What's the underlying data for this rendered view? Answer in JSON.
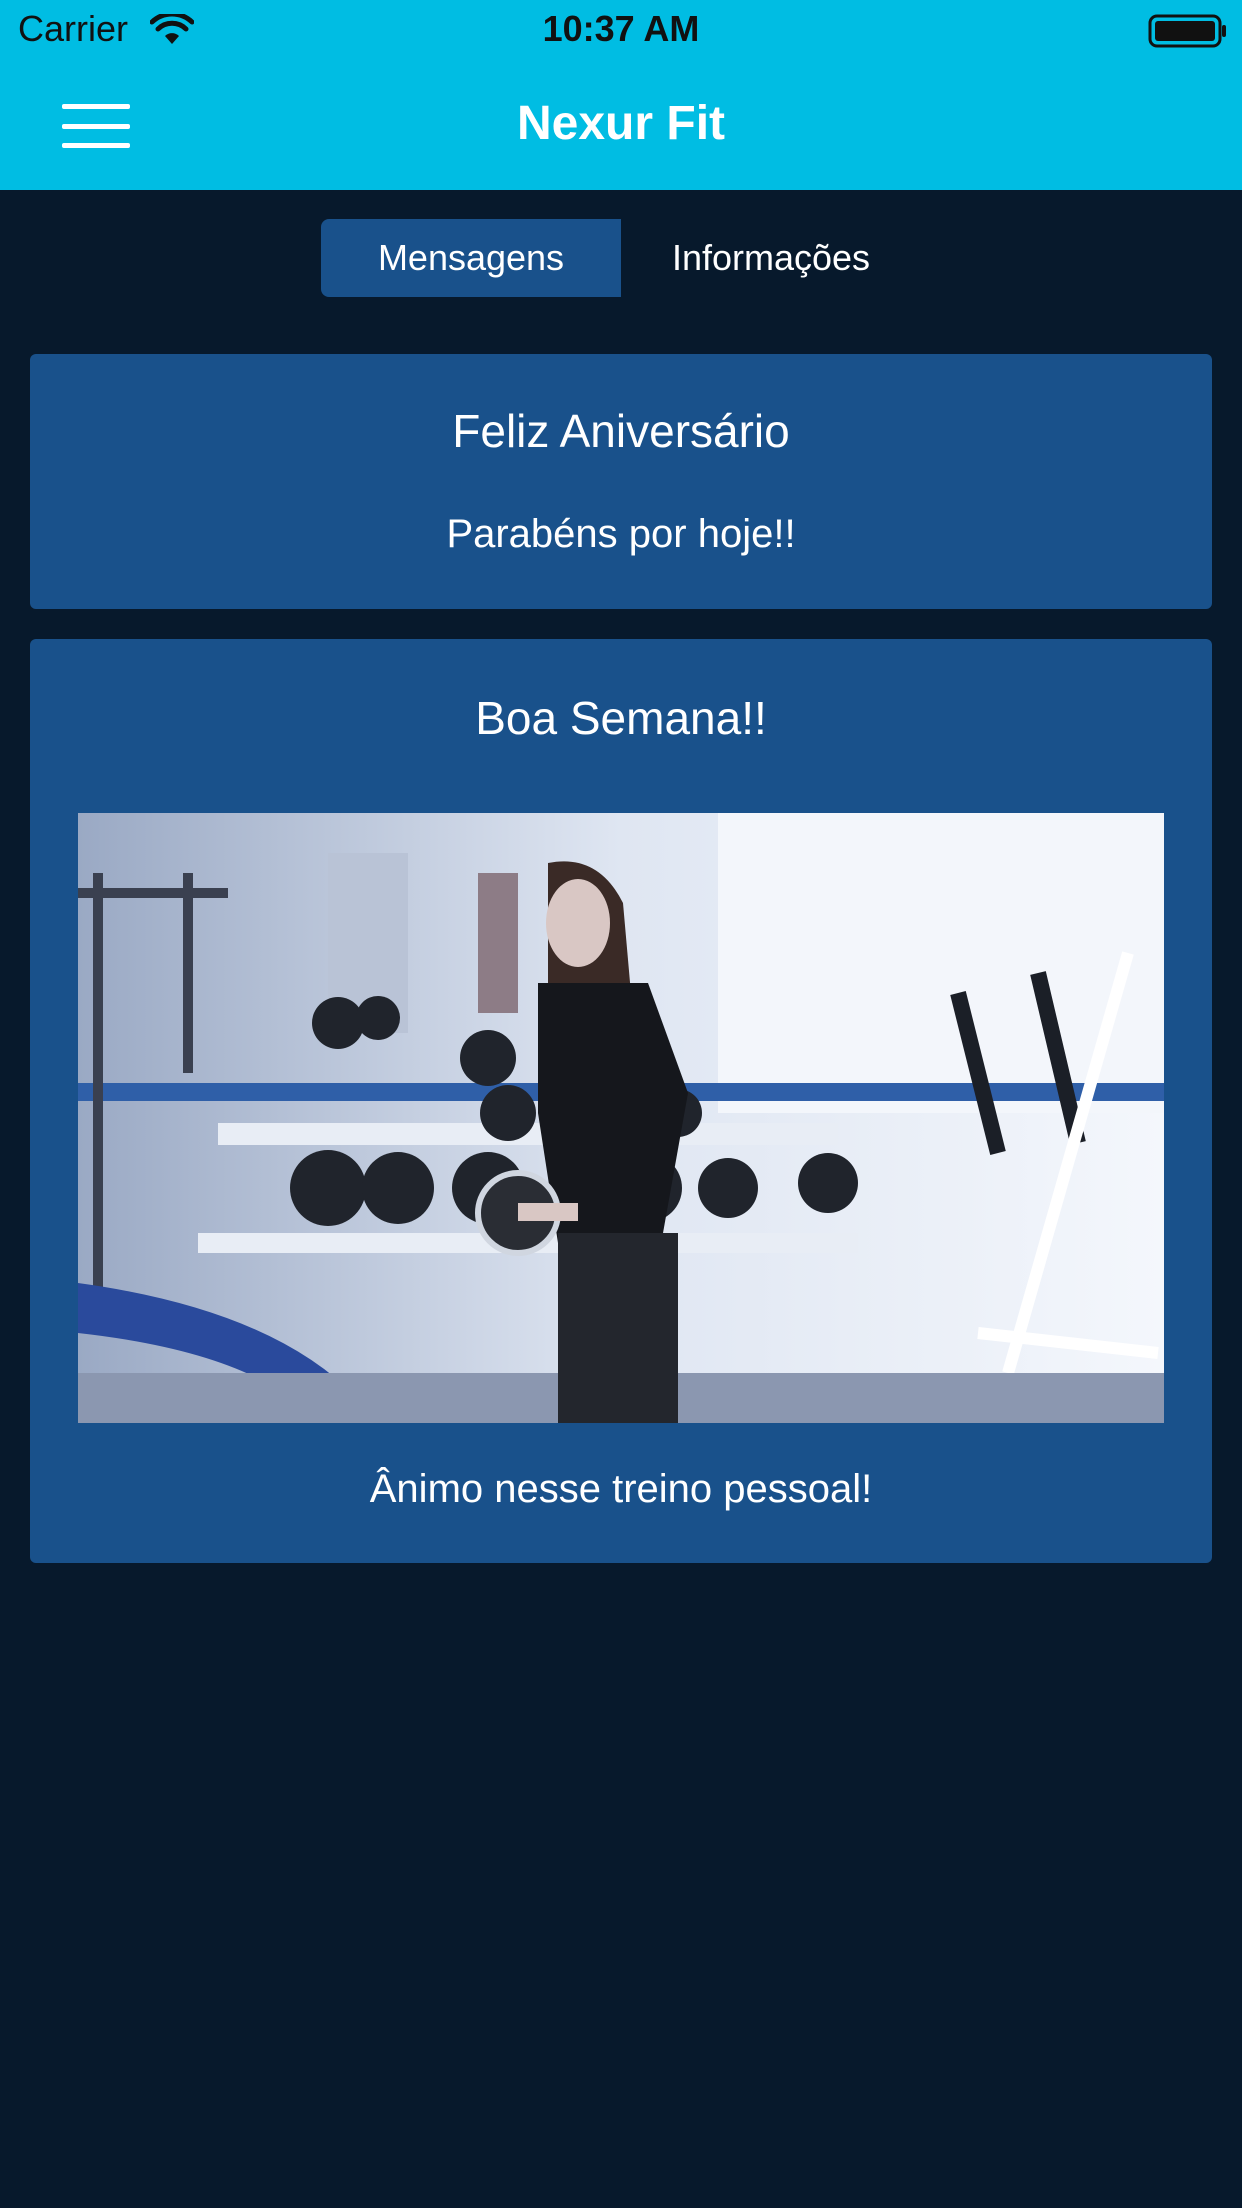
{
  "status_bar": {
    "carrier": "Carrier",
    "time": "10:37 AM",
    "wifi_icon": "wifi-icon",
    "battery_icon": "battery-icon"
  },
  "nav": {
    "title": "Nexur Fit",
    "menu_icon": "hamburger-menu-icon"
  },
  "tabs": [
    {
      "label": "Mensagens",
      "active": true
    },
    {
      "label": "Informações",
      "active": false
    }
  ],
  "messages": [
    {
      "title": "Feliz Aniversário",
      "body": "Parabéns por hoje!!"
    },
    {
      "title": "Boa Semana!!",
      "body": "Ânimo nesse treino pessoal!",
      "image": "gym-photo-woman-dumbbell"
    }
  ],
  "colors": {
    "header": "#00bde3",
    "background": "#07192c",
    "card": "#19518b",
    "text": "#ffffff"
  }
}
